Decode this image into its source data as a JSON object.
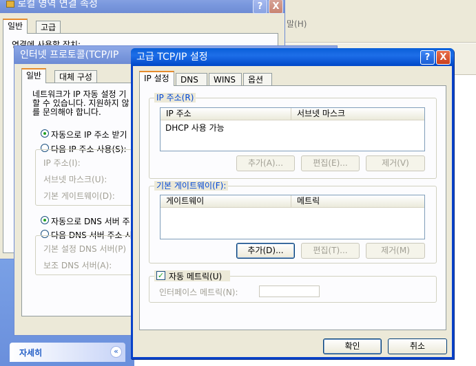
{
  "local_window": {
    "title": "로컬 영역 연결 속성",
    "tabs": [
      "일반",
      "고급"
    ],
    "truncated_text": "연결에 사용할 장치:",
    "help_btn": "?",
    "close_btn": "X"
  },
  "back_window": {
    "menu_help": "말(H)"
  },
  "left_panel": {
    "details_label": "자세히",
    "collapse_icon": "«"
  },
  "tcp_window": {
    "title": "인터넷 프로토콜(TCP/IP",
    "tabs": [
      "일반",
      "대체 구성"
    ],
    "desc": "네트워크가 IP 자동 설정 기\n할 수 있습니다. 지원하지 않\n를 문의해야 합니다.",
    "radio_auto_ip": "자동으로 IP 주소 받기",
    "radio_manual_ip": "다음 IP 주소 사용(S):",
    "ip_label": "IP 주소(I):",
    "subnet_label": "서브넷 마스크(U):",
    "gateway_label": "기본 게이트웨이(D):",
    "radio_auto_dns": "자동으로 DNS 서버 주",
    "radio_manual_dns": "다음 DNS 서버 주소 시",
    "pref_dns_label": "기본 설정 DNS 서버(P)",
    "alt_dns_label": "보조 DNS 서버(A):"
  },
  "adv_dialog": {
    "title": "고급 TCP/IP 설정",
    "help_btn": "?",
    "close_btn": "X",
    "tabs": [
      "IP 설정",
      "DNS",
      "WINS",
      "옵션"
    ],
    "ip_group": {
      "label": "IP 주소(R)",
      "columns": [
        "IP 주소",
        "서브넷 마스크"
      ],
      "rows": [
        "DHCP 사용 가능"
      ],
      "add": "추가(A)...",
      "edit": "편집(E)...",
      "remove": "제거(V)"
    },
    "gw_group": {
      "label": "기본 게이트웨이(F):",
      "columns": [
        "게이트웨이",
        "메트릭"
      ],
      "add": "추가(D)...",
      "edit": "편집(T)...",
      "remove": "제거(M)"
    },
    "auto_metric": {
      "label": "자동 메트릭(U)",
      "checked": true,
      "iface_label": "인터페이스 메트릭(N):",
      "iface_value": ""
    },
    "ok": "확인",
    "cancel": "취소"
  },
  "colors": {
    "xp_blue": "#0a5fd8",
    "xp_face": "#ece9d8",
    "tab_accent": "#e68b2c",
    "group_label": "#0046d5"
  }
}
